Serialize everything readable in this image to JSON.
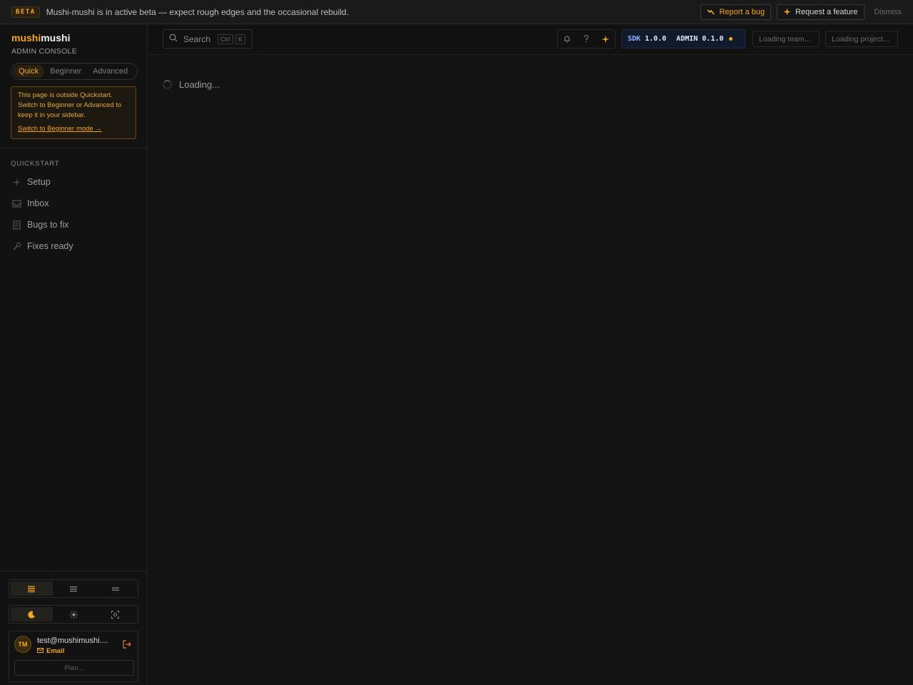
{
  "banner": {
    "badge": "BETA",
    "message": "Mushi-mushi is in active beta — expect rough edges and the occasional rebuild.",
    "report_bug": "Report a bug",
    "request_feature": "Request a feature",
    "dismiss": "Dismiss"
  },
  "brand": {
    "part1": "mushi",
    "part2": "mushi",
    "subtitle": "ADMIN CONSOLE"
  },
  "modes": [
    {
      "label": "Quick",
      "active": true
    },
    {
      "label": "Beginner",
      "active": false
    },
    {
      "label": "Advanced",
      "active": false
    }
  ],
  "notice": {
    "text": "This page is outside Quickstart. Switch to Beginner or Advanced to keep it in your sidebar.",
    "link": "Switch to Beginner mode →"
  },
  "sidebar": {
    "section_label": "QUICKSTART",
    "items": [
      {
        "label": "Setup",
        "icon": "sparkle-icon"
      },
      {
        "label": "Inbox",
        "icon": "inbox-icon"
      },
      {
        "label": "Bugs to fix",
        "icon": "document-icon"
      },
      {
        "label": "Fixes ready",
        "icon": "wrench-icon"
      }
    ]
  },
  "user": {
    "initials": "TM",
    "email": "test@mushimushi....",
    "auth": "Email",
    "plan": "Plan..."
  },
  "topbar": {
    "search_label": "Search",
    "kbd_ctrl": "Ctrl",
    "kbd_k": "K",
    "sdk_label": "SDK",
    "sdk_version": "1.0.0",
    "admin_label": "ADMIN",
    "admin_version": "0.1.0",
    "team": "Loading team...",
    "project": "Loading project..."
  },
  "main": {
    "loading": "Loading..."
  },
  "colors": {
    "accent": "#f5a524",
    "background": "#121212"
  }
}
